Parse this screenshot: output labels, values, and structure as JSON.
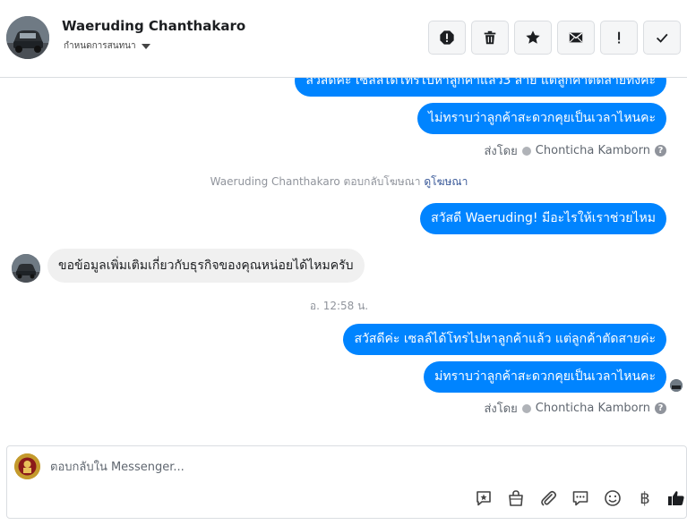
{
  "header": {
    "contact_name": "Waeruding Chanthakaro",
    "assign_label": "กำหนดการสนทนา",
    "actions": [
      {
        "name": "report-spam-icon"
      },
      {
        "name": "trash-icon"
      },
      {
        "name": "star-icon"
      },
      {
        "name": "mail-icon"
      },
      {
        "name": "exclamation-icon"
      },
      {
        "name": "check-icon"
      }
    ]
  },
  "thread": {
    "msg_out_1_partial": "สวัสดีค่ะ เซลล์ได้โทรไปหาลูกค้าแล้ว3 สาย แต่ลูกค้าตัดสายทิ้งค่ะ",
    "msg_out_2": "ไม่ทราบว่าลูกค้าสะดวกคุยเป็นเวลาไหนคะ",
    "sent_by_1_prefix": "ส่งโดย",
    "sent_by_1_name": "Chonticha Kamborn",
    "ad_reply_text": "Waeruding Chanthakaro ตอบกลับโฆษณา",
    "ad_link": "ดูโฆษณา",
    "msg_out_3": "สวัสดี Waeruding! มีอะไรให้เราช่วยไหม",
    "msg_in_1": "ขอข้อมูลเพิ่มเติมเกี่ยวกับธุรกิจของคุณหน่อยได้ไหมครับ",
    "timestamp": "อ. 12:58 น.",
    "msg_out_4": "สวัสดีค่ะ เซลล์ได้โทรไปหาลูกค้าแล้ว แต่ลูกค้าตัดสายค่ะ",
    "msg_out_5": "ม่ทราบว่าลูกค้าสะดวกคุยเป็นเวลาไหนคะ",
    "sent_by_2_prefix": "ส่งโดย",
    "sent_by_2_name": "Chonticha Kamborn",
    "help_glyph": "?"
  },
  "composer": {
    "placeholder": "ตอบกลับใน Messenger...",
    "icons": [
      "saved-reply-icon",
      "shop-bag-icon",
      "attachment-icon",
      "quick-reply-icon",
      "emoji-icon",
      "baht-icon",
      "like-icon"
    ],
    "baht_glyph": "฿"
  },
  "colors": {
    "bubble_out": "#0084ff",
    "bubble_in": "#f0f0f0",
    "link": "#385898"
  }
}
